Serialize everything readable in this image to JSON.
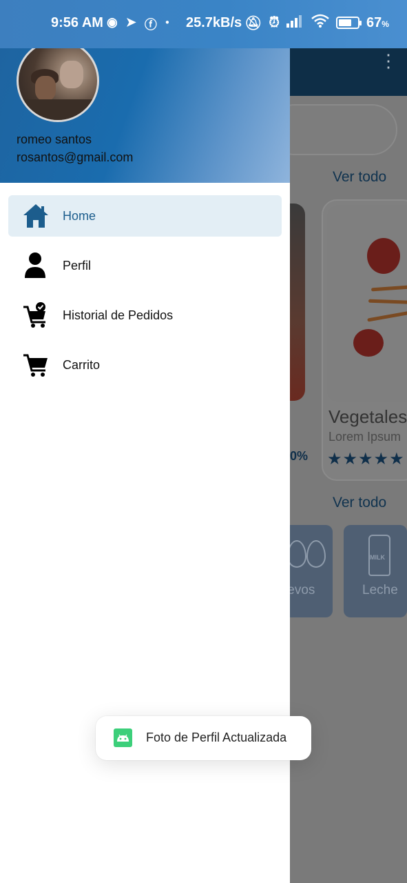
{
  "status_bar": {
    "time": "9:56 AM",
    "speed": "25.7kB/s",
    "battery_percent": "67",
    "battery_unit": "%",
    "icons_left": [
      "messenger-icon",
      "telegram-icon",
      "facebook-icon",
      "dot-icon"
    ],
    "icons_right": [
      "mute-icon",
      "alarm-icon",
      "signal-icon",
      "wifi-icon",
      "battery-icon"
    ]
  },
  "drawer": {
    "user_name": "romeo santos",
    "user_email": "rosantos@gmail.com",
    "items": [
      {
        "label": "Home",
        "icon": "home-icon",
        "active": true
      },
      {
        "label": "Perfil",
        "icon": "person-icon",
        "active": false
      },
      {
        "label": "Historial de Pedidos",
        "icon": "cart-check-icon",
        "active": false
      },
      {
        "label": "Carrito",
        "icon": "cart-icon",
        "active": false
      }
    ]
  },
  "background_screen": {
    "see_all_1": "Ver todo",
    "see_all_2": "Ver todo",
    "product_title": "Vegetales",
    "product_subtitle": "Lorem Ipsum",
    "product_rating": "★★★★★",
    "discount_partial": "0%",
    "category_1": "Huevos",
    "category_2": "Leche",
    "milk_label": "MILK"
  },
  "toast": {
    "message": "Foto de Perfil Actualizada"
  },
  "colors": {
    "header_blue": "#1a6cae",
    "active_item_bg": "#e3eef5",
    "active_item_text": "#1c5d8d",
    "toast_icon": "#3ccf7a"
  }
}
